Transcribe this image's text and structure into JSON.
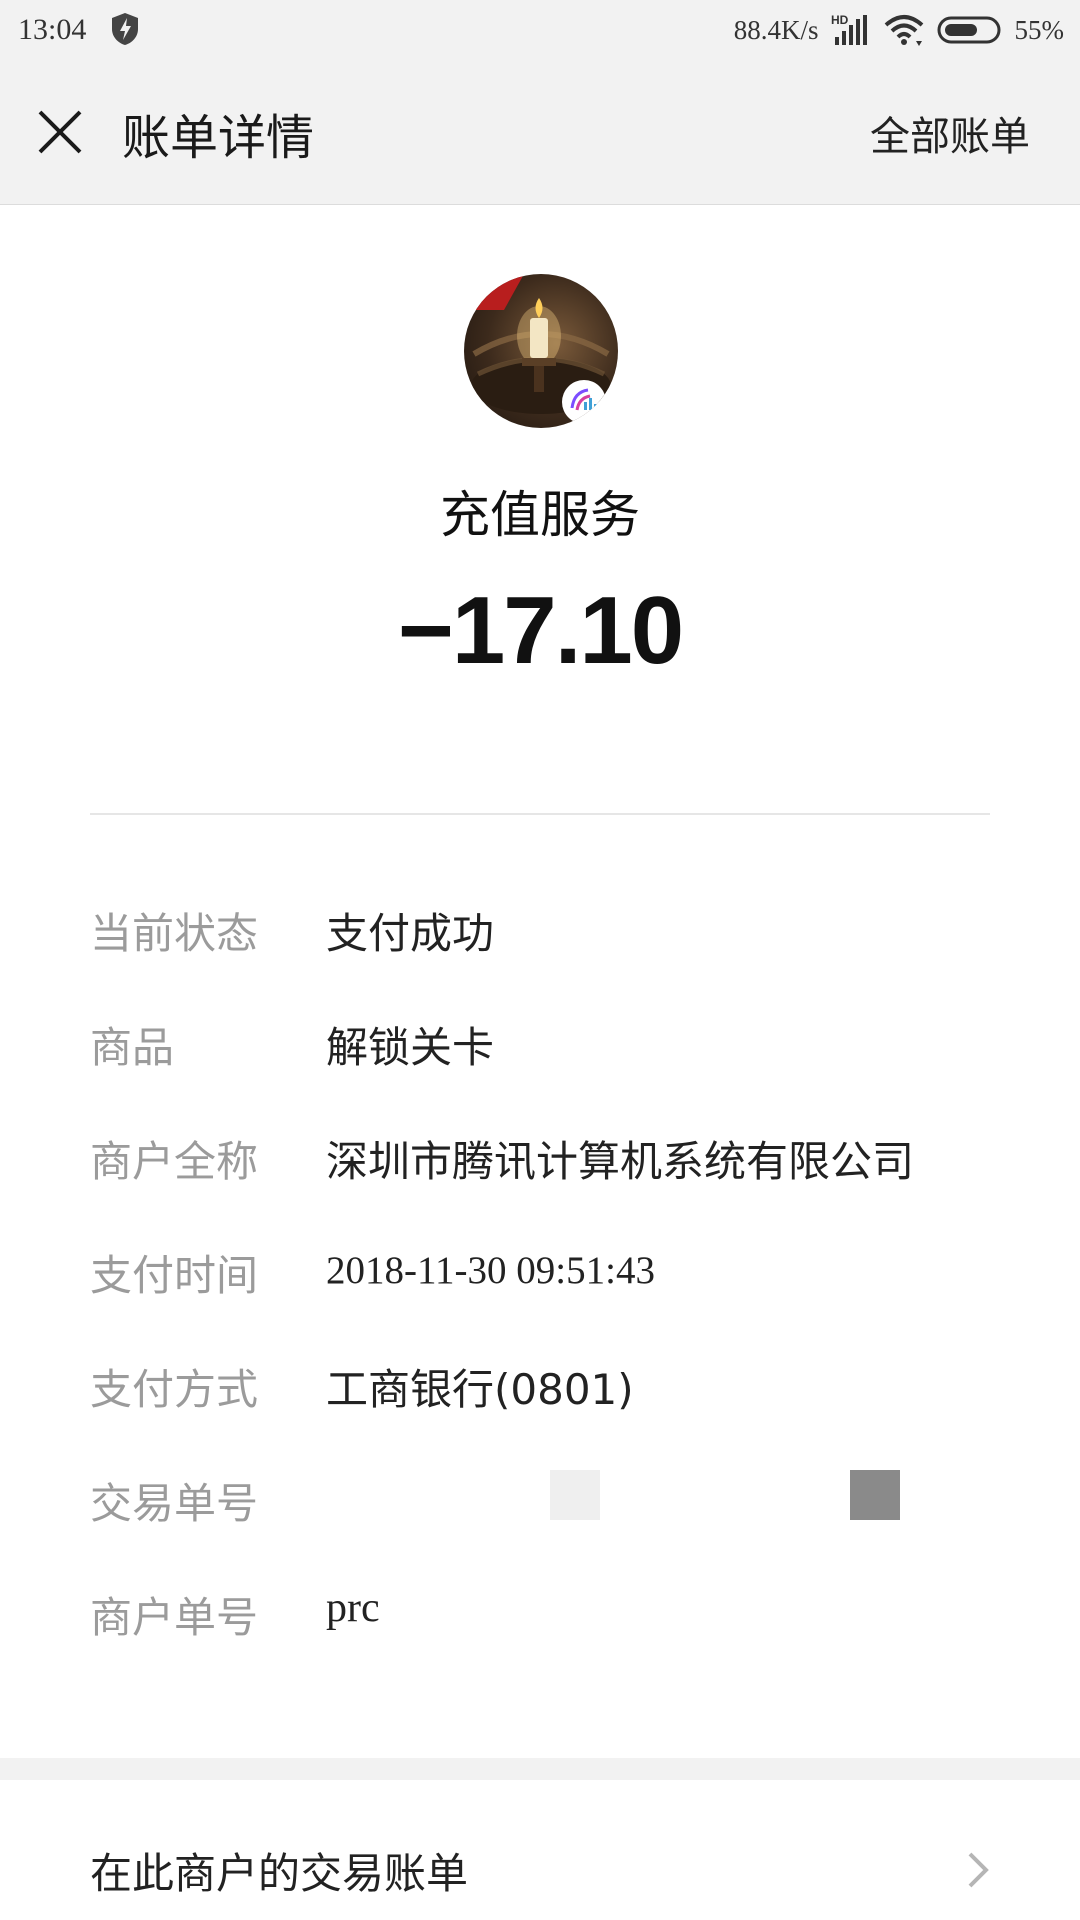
{
  "status_bar": {
    "time": "13:04",
    "network_speed": "88.4K/s",
    "network_label": "HD",
    "battery": "55%",
    "icons": [
      "shield-icon",
      "signal-icon",
      "wifi-icon",
      "battery-icon"
    ]
  },
  "nav": {
    "title": "账单详情",
    "all_bills": "全部账单",
    "close_icon": "close-icon"
  },
  "merchant": {
    "name": "充值服务",
    "amount": "−17.10"
  },
  "details": [
    {
      "label": "当前状态",
      "value": "支付成功"
    },
    {
      "label": "商品",
      "value": "解锁关卡"
    },
    {
      "label": "商户全称",
      "value": "深圳市腾讯计算机系统有限公司"
    },
    {
      "label": "支付时间",
      "value": "2018-11-30 09:51:43"
    },
    {
      "label": "支付方式",
      "value": "工商银行(0801)"
    },
    {
      "label": "交易单号",
      "value": ""
    },
    {
      "label": "商户单号",
      "value": "prc"
    }
  ],
  "bottom": {
    "label": "在此商户的交易账单",
    "chevron_icon": "chevron-right-icon"
  },
  "colors": {
    "header_bg": "#f2f2f2",
    "label_gray": "#9b9b9b",
    "text_dark": "#1b1b1b"
  }
}
